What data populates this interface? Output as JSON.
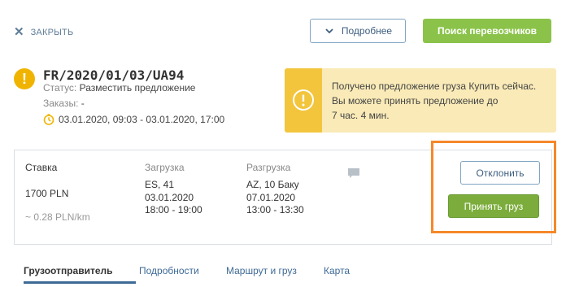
{
  "header": {
    "close_label": "ЗАКРЫТЬ",
    "more_label": "Подробнее",
    "search_carriers_label": "Поиск перевозчиков"
  },
  "order": {
    "id": "FR/2020/01/03/UA94",
    "status_key": "Статус:",
    "status_value": "Разместить предложение",
    "orders_key": "Заказы:",
    "orders_value": "-",
    "date_range": "03.01.2020, 09:03 - 03.01.2020, 17:00"
  },
  "notice": {
    "line1": "Получено предложение груза Купить сейчас.",
    "line2": "Вы можете принять предложение до",
    "line3": "7 час. 4 мин."
  },
  "offer": {
    "rate_label": "Ставка",
    "rate_value": "1700  PLN",
    "rate_per_km": "~ 0.28 PLN/km",
    "loading": {
      "header": "Загрузка",
      "place": "ES, 41",
      "date": "03.01.2020",
      "time": "18:00 - 19:00"
    },
    "unloading": {
      "header": "Разгрузка",
      "place": "AZ, 10 Баку",
      "date": "07.01.2020",
      "time": "13:00 - 13:30"
    },
    "reject_label": "Отклонить",
    "accept_label": "Принять груз"
  },
  "tabs": [
    {
      "label": "Грузоотправитель",
      "active": true
    },
    {
      "label": "Подробности",
      "active": false
    },
    {
      "label": "Маршрут и груз",
      "active": false
    },
    {
      "label": "Карта",
      "active": false
    }
  ],
  "colors": {
    "primary_green": "#8bc34a",
    "accept_green": "#7cad3c",
    "warning_yellow": "#f0b400",
    "notice_bg": "#f9eab7",
    "highlight_orange": "#f5882a",
    "link_blue": "#3e6a96"
  },
  "icons": {
    "close": "close-icon",
    "more": "chevron-down-icon",
    "warning": "warning-icon",
    "clock": "clock-icon",
    "notice": "alert-circle-icon",
    "chat": "chat-icon"
  }
}
